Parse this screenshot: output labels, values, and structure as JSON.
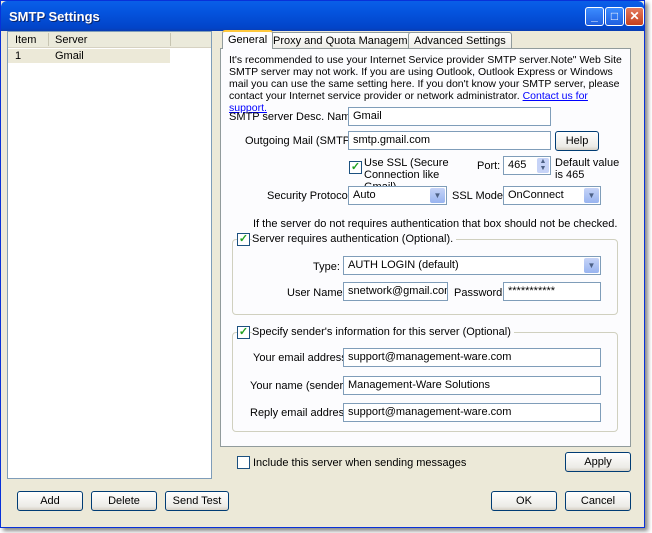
{
  "window": {
    "title": "SMTP Settings",
    "buttons": [
      "minimize",
      "maximize",
      "close"
    ]
  },
  "server_list": {
    "columns": [
      "Item",
      "Server"
    ],
    "rows": [
      {
        "item": "1",
        "server": "Gmail"
      }
    ]
  },
  "tabs": [
    "General",
    "Proxy and Quota Management",
    "Advanced Settings"
  ],
  "general": {
    "info_text": "It's recommended to use your Internet Service provider SMTP server.Note\" Web Site SMTP server may not work. If you are using Outlook, Outlook Express or Windows mail you can use the same setting here. If you don't know your SMTP server, please contact your Internet service provider or network administrator.",
    "contact_link": "Contact us for support.",
    "desc_name_label": "SMTP server Desc. Name:",
    "desc_name_value": "Gmail",
    "outgoing_label": "Outgoing Mail (SMTP):",
    "outgoing_value": "smtp.gmail.com",
    "help_label": "Help",
    "use_ssl_label": "Use SSL (Secure Connection like Gmail)",
    "use_ssl_checked": true,
    "port_label": "Port:",
    "port_value": "465",
    "port_hint": "Default value is 465",
    "security_protocol_label": "Security Protocol:",
    "security_protocol_value": "Auto",
    "ssl_mode_label": "SSL Mode:",
    "ssl_mode_value": "OnConnect",
    "auth_note": "If the server do not requires authentication that box should not be checked.",
    "auth_label": "Server requires authentication (Optional).",
    "auth_checked": true,
    "type_label": "Type:",
    "type_value": "AUTH LOGIN (default)",
    "username_label": "User Name:",
    "username_value": "snetwork@gmail.com",
    "password_label": "Password:",
    "password_value": "***********",
    "sender_label": "Specify sender's information for this server (Optional)",
    "sender_checked": true,
    "email_label": "Your email address:",
    "email_value": "support@management-ware.com",
    "name_label": "Your name (sender):",
    "name_value": "Management-Ware Solutions",
    "reply_label": "Reply email address:",
    "reply_value": "support@management-ware.com"
  },
  "include_label": "Include this server when sending messages",
  "include_checked": false,
  "buttons": {
    "apply": "Apply",
    "add": "Add",
    "delete": "Delete",
    "send_test": "Send Test",
    "ok": "OK",
    "cancel": "Cancel"
  }
}
